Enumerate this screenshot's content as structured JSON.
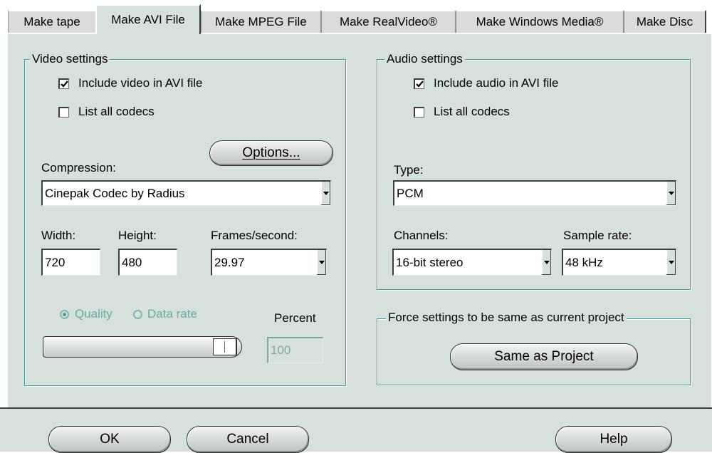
{
  "tabs": [
    "Make tape",
    "Make AVI File",
    "Make MPEG File",
    "Make RealVideo®",
    "Make Windows Media®",
    "Make Disc"
  ],
  "active_tab": "Make AVI File",
  "video": {
    "legend": "Video settings",
    "include_label": "Include video in AVI file",
    "include_checked": true,
    "list_codecs_label": "List all codecs",
    "list_codecs_checked": false,
    "options_button": "Options...",
    "compression_label": "Compression:",
    "compression_value": "Cinepak Codec by Radius",
    "width_label": "Width:",
    "width_value": "720",
    "height_label": "Height:",
    "height_value": "480",
    "fps_label": "Frames/second:",
    "fps_value": "29.97",
    "quality_label": "Quality",
    "datarate_label": "Data rate",
    "percent_label": "Percent",
    "percent_value": "100",
    "quality_slider_level": 1.0
  },
  "audio": {
    "legend": "Audio settings",
    "include_label": "Include audio in AVI file",
    "include_checked": true,
    "list_codecs_label": "List all codecs",
    "list_codecs_checked": false,
    "type_label": "Type:",
    "type_value": "PCM",
    "channels_label": "Channels:",
    "channels_value": "16-bit stereo",
    "samplerate_label": "Sample rate:",
    "samplerate_value": "48 kHz"
  },
  "force": {
    "legend": "Force settings to be same as current project",
    "button": "Same as Project"
  },
  "footer": {
    "ok": "OK",
    "cancel": "Cancel",
    "help": "Help"
  },
  "colors": {
    "panel": "#d6e1dc",
    "group_border": "#3f9c9c",
    "disabled_text": "#6fa8a2"
  }
}
